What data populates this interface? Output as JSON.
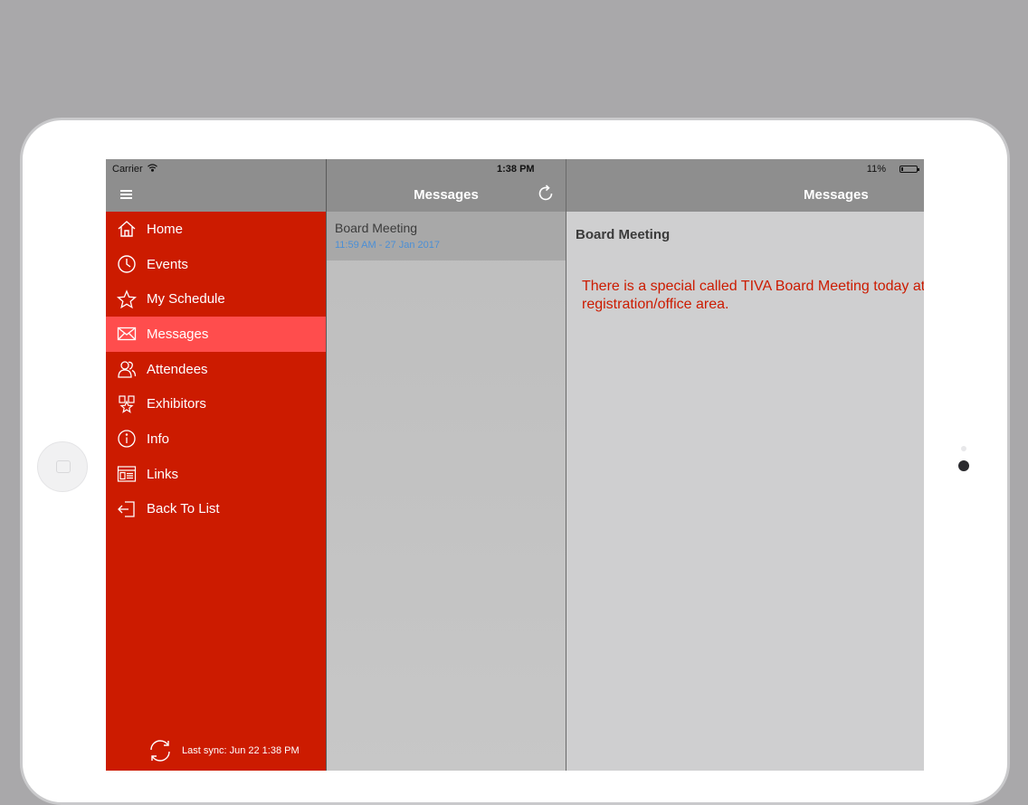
{
  "status": {
    "carrier": "Carrier",
    "time": "1:38 PM",
    "battery": "11%"
  },
  "sidebar": {
    "items": [
      {
        "label": "Home",
        "icon": "home-icon"
      },
      {
        "label": "Events",
        "icon": "clock-icon"
      },
      {
        "label": "My Schedule",
        "icon": "star-icon"
      },
      {
        "label": "Messages",
        "icon": "envelope-icon",
        "active": true
      },
      {
        "label": "Attendees",
        "icon": "people-icon"
      },
      {
        "label": "Exhibitors",
        "icon": "exhibitor-icon"
      },
      {
        "label": "Info",
        "icon": "info-icon"
      },
      {
        "label": "Links",
        "icon": "links-icon"
      },
      {
        "label": "Back To List",
        "icon": "exit-icon"
      }
    ],
    "sync_text": "Last sync:  Jun 22 1:38 PM"
  },
  "middle": {
    "title": "Messages",
    "messages": [
      {
        "title": "Board Meeting",
        "time": "11:59 AM - 27 Jan 2017"
      }
    ]
  },
  "detail": {
    "title": "Messages",
    "subject": "Board Meeting",
    "body": "There is a special called TIVA Board Meeting today at registration/office area."
  },
  "colors": {
    "sidebar_bg": "#cc1b00",
    "active_item": "#ff4d4d",
    "header_gray": "#8e8e8e",
    "link_blue": "#4b8fd6"
  }
}
